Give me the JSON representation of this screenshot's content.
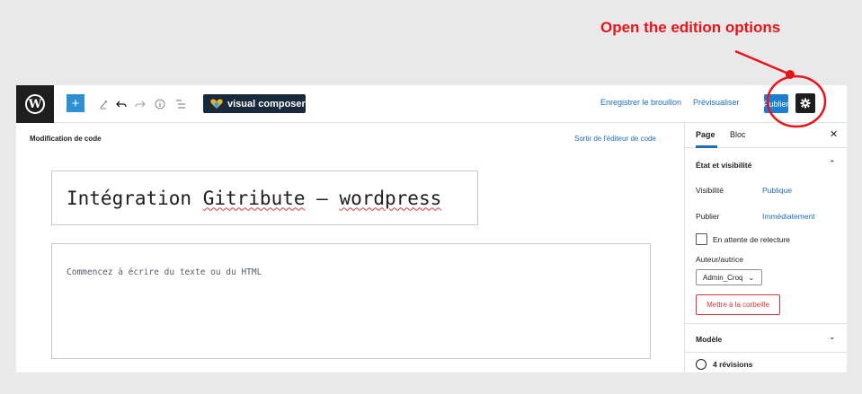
{
  "annotation": {
    "text": "Open the edition options",
    "color": "#e8141a"
  },
  "topbar": {
    "logo": "W",
    "add_icon": "plus-icon",
    "tools": [
      "pencil-icon",
      "undo-icon",
      "redo-icon",
      "info-icon",
      "list-view-icon"
    ],
    "visual_composer_label": "visual composer",
    "save_draft_label": "Enregistrer le brouillon",
    "preview_label": "Prévisualiser",
    "publish_label": "Publier",
    "settings_icon": "gear-icon",
    "accent": "#1e7fd0"
  },
  "code_editor": {
    "mode_label": "Modification de code",
    "exit_label": "Sortir de l'éditeur de code",
    "title_before": "Intégration ",
    "title_word1": "Gitribute",
    "title_middle": " – ",
    "title_word2": "wordpress",
    "content_placeholder": "Commencez à écrire du texte ou du HTML"
  },
  "sidebar": {
    "tabs": [
      "Page",
      "Bloc"
    ],
    "close_icon": "close-icon",
    "status_section_title": "État et visibilité",
    "visibility_label": "Visibilité",
    "visibility_value": "Publique",
    "publish_label": "Publier",
    "publish_value": "Immédiatement",
    "pending_review_label": "En attente de relecture",
    "author_label": "Auteur/autrice",
    "author_value": "Admin_Croq",
    "trash_label": "Mettre à la corbeille",
    "template_section_title": "Modèle",
    "revisions_label": "4 révisions"
  }
}
